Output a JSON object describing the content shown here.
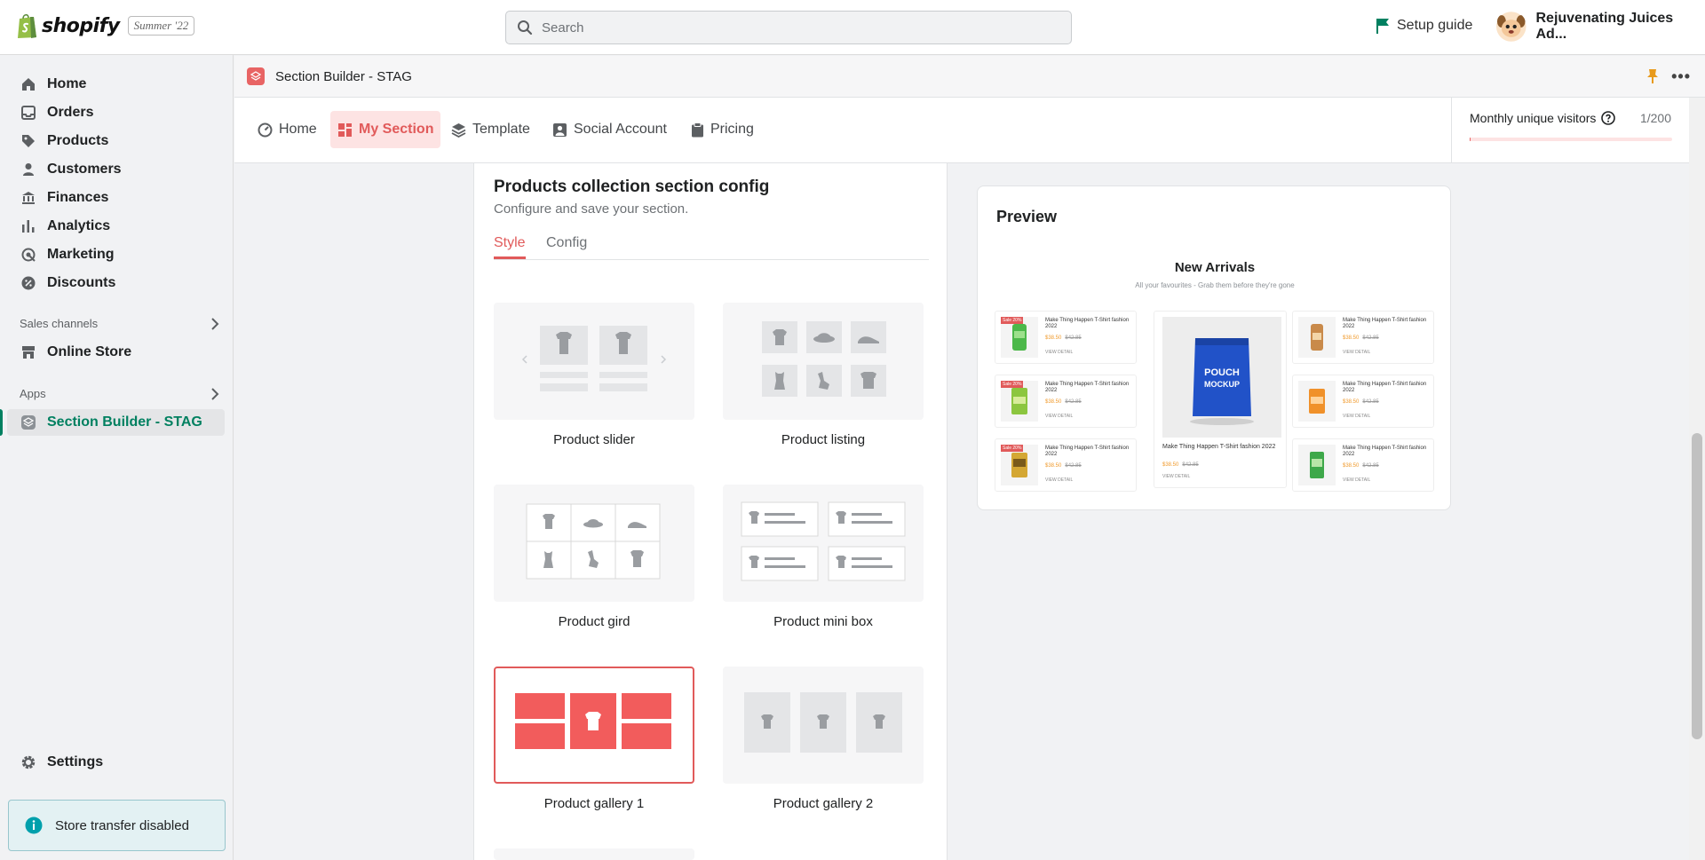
{
  "topbar": {
    "brand": "shopify",
    "edition": "Summer '22",
    "search_placeholder": "Search",
    "setup_guide": "Setup guide",
    "store_name": "Rejuvenating Juices Ad..."
  },
  "sidebar": {
    "items": [
      {
        "label": "Home",
        "icon": "home-icon"
      },
      {
        "label": "Orders",
        "icon": "orders-icon"
      },
      {
        "label": "Products",
        "icon": "tag-icon"
      },
      {
        "label": "Customers",
        "icon": "person-icon"
      },
      {
        "label": "Finances",
        "icon": "bank-icon"
      },
      {
        "label": "Analytics",
        "icon": "bar-chart-icon"
      },
      {
        "label": "Marketing",
        "icon": "target-icon"
      },
      {
        "label": "Discounts",
        "icon": "discount-icon"
      }
    ],
    "sales_channels_label": "Sales channels",
    "online_store": "Online Store",
    "apps_label": "Apps",
    "active_app": "Section Builder - STAG",
    "settings": "Settings",
    "banner": "Store transfer disabled"
  },
  "app": {
    "title": "Section Builder - STAG",
    "tabs": [
      {
        "label": "Home",
        "icon": "gauge-icon"
      },
      {
        "label": "My Section",
        "icon": "grid-icon",
        "active": true
      },
      {
        "label": "Template",
        "icon": "layers-icon"
      },
      {
        "label": "Social Account",
        "icon": "account-icon"
      },
      {
        "label": "Pricing",
        "icon": "clipboard-icon"
      }
    ],
    "visitors_label": "Monthly unique visitors",
    "visitors_count": "1/200",
    "visitors_fraction": 0.005
  },
  "config": {
    "title": "Products collection section config",
    "subtitle": "Configure and save your section.",
    "subtabs": [
      "Style",
      "Config"
    ],
    "styles": [
      {
        "name": "Product slider"
      },
      {
        "name": "Product listing"
      },
      {
        "name": "Product gird"
      },
      {
        "name": "Product mini box"
      },
      {
        "name": "Product gallery 1",
        "selected": true
      },
      {
        "name": "Product gallery 2"
      }
    ]
  },
  "preview": {
    "title": "Preview",
    "heading": "New Arrivals",
    "subheading": "All your favourites - Grab them before they're gone",
    "product_title": "Make Thing Happen T-Shirt fashion 2022",
    "price_now": "$38.50",
    "price_was": "$42.85",
    "view_detail": "VIEW DETAIL",
    "sale_badge": "Sale 20%",
    "center_product_title": "Make Thing Happen T-Shirt fashion 2022",
    "mockup_text": "POUCH MOCKUP"
  },
  "colors": {
    "accent": "#e15a5a",
    "shopify_green": "#008060",
    "info_bg": "#e3f1f3"
  }
}
